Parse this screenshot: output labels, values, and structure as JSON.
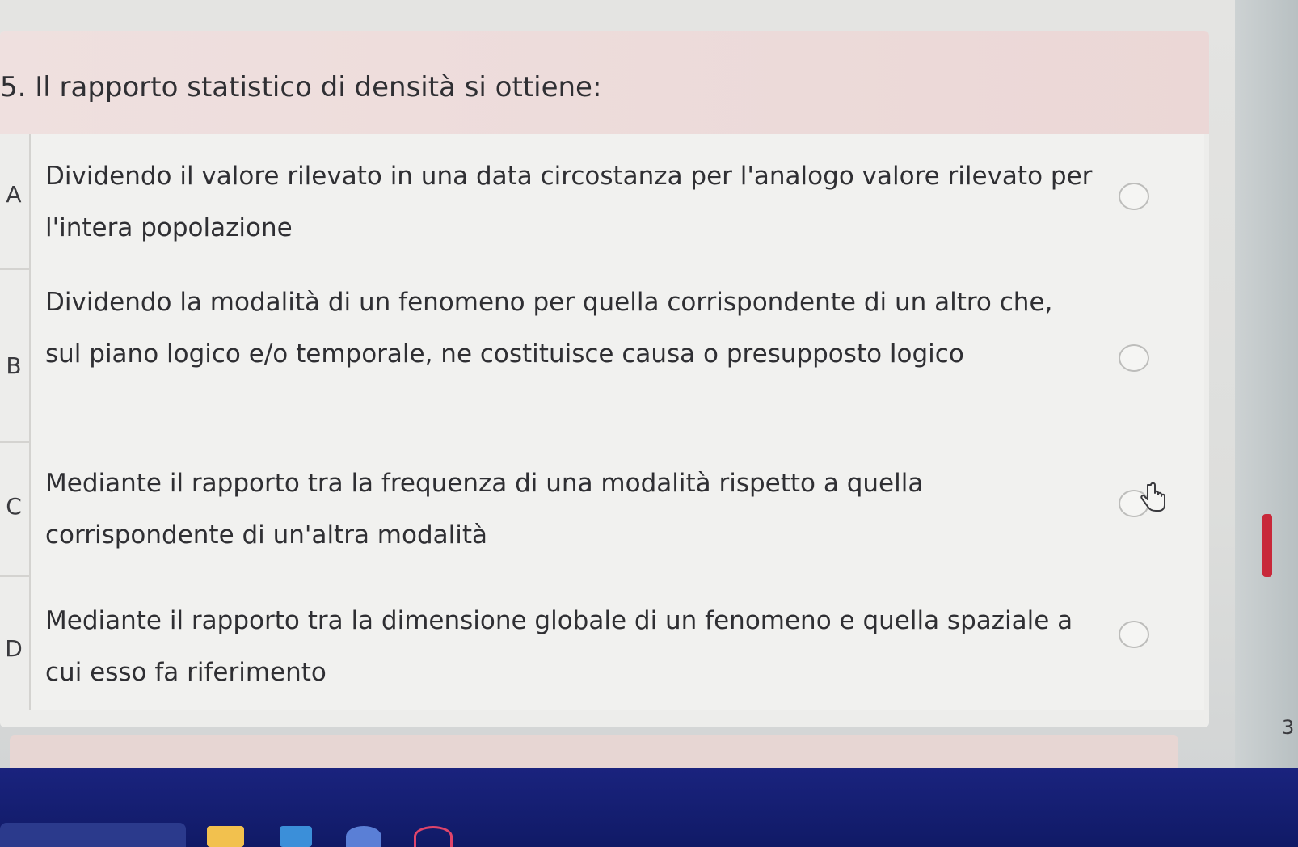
{
  "question": {
    "text": "5. Il rapporto statistico di densità si ottiene:"
  },
  "answers": [
    {
      "letter": "A",
      "text": "Dividendo il valore rilevato in una data circostanza per l'analogo valore rilevato per l'intera popolazione"
    },
    {
      "letter": "B",
      "text": "Dividendo la modalità di un fenomeno per quella corrispondente di un altro che, sul piano logico e/o temporale, ne costituisce causa o presupposto logico"
    },
    {
      "letter": "C",
      "text": "Mediante il rapporto tra la frequenza di una modalità rispetto a quella corrispondente di un'altra modalità"
    },
    {
      "letter": "D",
      "text": "Mediante il rapporto tra la dimensione globale di un fenomeno e quella spaziale a cui esso fa riferimento"
    }
  ],
  "side_partial_text": "3",
  "colors": {
    "header_bg": "#ebd7d6",
    "answer_bg": "#f1f1ef",
    "accent_red": "#c8283a",
    "taskbar": "#1a237e"
  },
  "icons": {
    "cursor": "hand-pointer-icon",
    "radio": "radio-circle-icon"
  }
}
